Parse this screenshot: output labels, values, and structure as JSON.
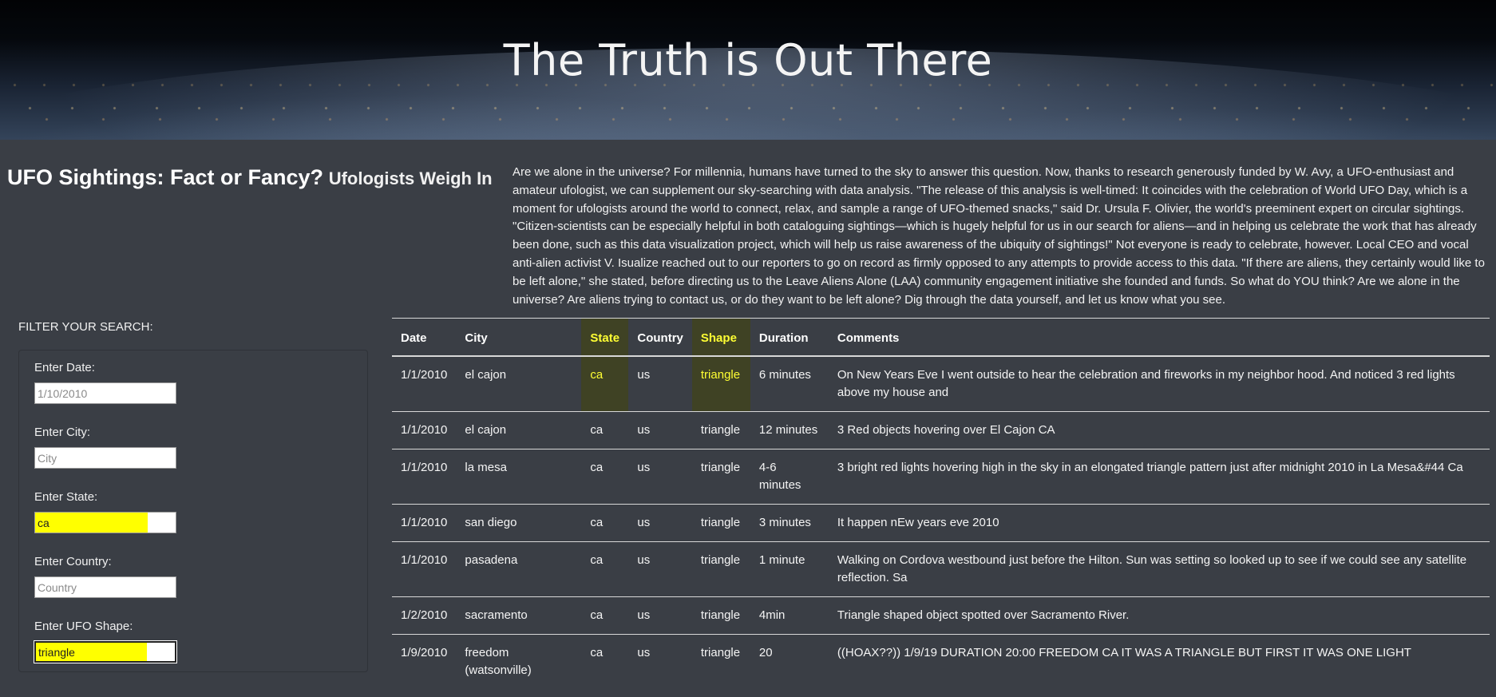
{
  "hero": {
    "title": "The Truth is Out There"
  },
  "header": {
    "title_main": "UFO Sightings: Fact or Fancy?",
    "title_sub": "Ufologists Weigh In"
  },
  "intro_text": "Are we alone in the universe? For millennia, humans have turned to the sky to answer this question. Now, thanks to research generously funded by W. Avy, a UFO-enthusiast and amateur ufologist, we can supplement our sky-searching with data analysis. \"The release of this analysis is well-timed: It coincides with the celebration of World UFO Day, which is a moment for ufologists around the world to connect, relax, and sample a range of UFO-themed snacks,\" said Dr. Ursula F. Olivier, the world's preeminent expert on circular sightings. \"Citizen-scientists can be especially helpful in both cataloguing sightings—which is hugely helpful for us in our search for aliens—and in helping us celebrate the work that has already been done, such as this data visualization project, which will help us raise awareness of the ubiquity of sightings!\" Not everyone is ready to celebrate, however. Local CEO and vocal anti-alien activist V. Isualize reached out to our reporters to go on record as firmly opposed to any attempts to provide access to this data. \"If there are aliens, they certainly would like to be left alone,\" she stated, before directing us to the Leave Aliens Alone (LAA) community engagement initiative she founded and funds. So what do YOU think? Are we alone in the universe? Are aliens trying to contact us, or do they want to be left alone? Dig through the data yourself, and let us know what you see.",
  "filters": {
    "heading": "FILTER YOUR SEARCH:",
    "date": {
      "label": "Enter Date:",
      "placeholder": "1/10/2010",
      "value": ""
    },
    "city": {
      "label": "Enter City:",
      "placeholder": "City",
      "value": ""
    },
    "state": {
      "label": "Enter State:",
      "placeholder": "",
      "value": "ca"
    },
    "country": {
      "label": "Enter Country:",
      "placeholder": "Country",
      "value": ""
    },
    "shape": {
      "label": "Enter UFO Shape:",
      "placeholder": "",
      "value": "triangle"
    }
  },
  "table": {
    "headers": [
      "Date",
      "City",
      "State",
      "Country",
      "Shape",
      "Duration",
      "Comments"
    ],
    "rows": [
      [
        "1/1/2010",
        "el cajon",
        "ca",
        "us",
        "triangle",
        "6 minutes",
        "On New Years Eve I went outside to hear the celebration and fireworks in my neighbor hood. And noticed 3 red lights above my house and"
      ],
      [
        "1/1/2010",
        "el cajon",
        "ca",
        "us",
        "triangle",
        "12 minutes",
        "3 Red objects hovering over El Cajon CA"
      ],
      [
        "1/1/2010",
        "la mesa",
        "ca",
        "us",
        "triangle",
        "4-6 minutes",
        "3 bright red lights hovering high in the sky in an elongated triangle pattern just after midnight 2010 in La Mesa&#44 Ca"
      ],
      [
        "1/1/2010",
        "san diego",
        "ca",
        "us",
        "triangle",
        "3 minutes",
        "It happen nEw years eve 2010"
      ],
      [
        "1/1/2010",
        "pasadena",
        "ca",
        "us",
        "triangle",
        "1 minute",
        "Walking on Cordova westbound just before the Hilton. Sun was setting so looked up to see if we could see any satellite reflection. Sa"
      ],
      [
        "1/2/2010",
        "sacramento",
        "ca",
        "us",
        "triangle",
        "4min",
        "Triangle shaped object spotted over Sacramento River."
      ],
      [
        "1/9/2010",
        "freedom (watsonville)",
        "ca",
        "us",
        "triangle",
        "20",
        "((HOAX??)) 1/9/19 DURATION 20:00 FREEDOM CA IT WAS A TRIANGLE BUT FIRST IT WAS ONE LIGHT"
      ]
    ]
  },
  "colors": {
    "highlight": "#ffff00",
    "page_bg": "#3a3e45"
  }
}
